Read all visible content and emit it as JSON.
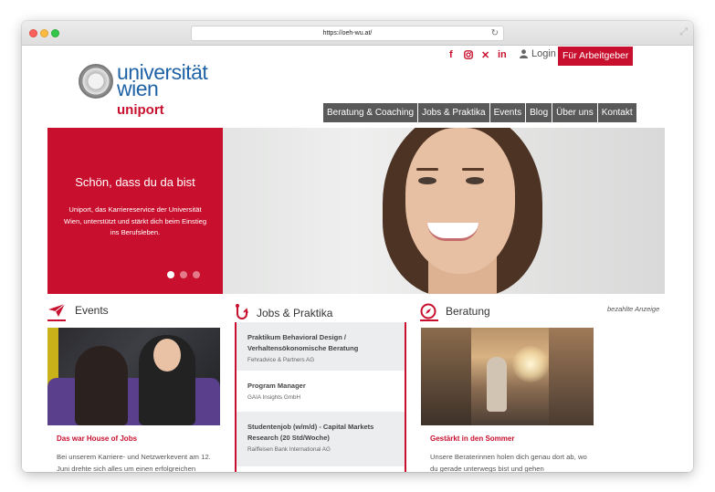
{
  "browser": {
    "url": "https://oeh-wu.at/",
    "reload_icon": "reload-icon",
    "expand_icon": "expand-icon"
  },
  "topbar": {
    "social": [
      "f",
      "instagram",
      "xing",
      "in"
    ],
    "social_icons": [
      "facebook-icon",
      "instagram-icon",
      "xing-icon",
      "linkedin-icon"
    ],
    "login_label": "Login",
    "employer_label": "Für Arbeitgeber"
  },
  "logo": {
    "line1": "universität",
    "line2": "wien",
    "subbrand": "uniport"
  },
  "nav": {
    "items": [
      "Beratung & Coaching",
      "Jobs & Praktika",
      "Events",
      "Blog",
      "Über uns",
      "Kontakt"
    ]
  },
  "hero": {
    "title": "Schön, dass du da bist",
    "text": "Uniport, das Karriereservice der Universität Wien, unterstützt und stärkt dich beim Einstieg ins Berufsleben.",
    "slides": 3,
    "active_slide": 1
  },
  "sections": {
    "events": {
      "heading": "Events",
      "icon": "paper-plane-icon",
      "link": "Das war House of Jobs",
      "text": "Bei unserem Karriere- und Netzwerkevent am 12. Juni drehte sich alles um einen erfolgreichen"
    },
    "jobs": {
      "heading": "Jobs & Praktika",
      "icon": "hook-icon",
      "ad_label": "bezahlte Anzeige",
      "listings": [
        {
          "title": "Praktikum Behavioral Design / Verhaltensökonomische Beratung",
          "company": "Fehradvice & Partners AG"
        },
        {
          "title": "Program Manager",
          "company": "GAIA Insights GmbH"
        },
        {
          "title": "Studentenjob (w/m/d) - Capital Markets Research (20 Std/Woche)",
          "company": "Raiffeisen Bank International AG"
        }
      ]
    },
    "beratung": {
      "heading": "Beratung",
      "icon": "compass-icon",
      "link": "Gestärkt in den Sommer",
      "text": "Unsere Beraterinnen holen dich genau dort ab, wo du gerade unterwegs bist und gehen"
    }
  },
  "colors": {
    "accent": "#c8102e",
    "nav_bg": "#595959",
    "brand_blue": "#1f63a6"
  }
}
